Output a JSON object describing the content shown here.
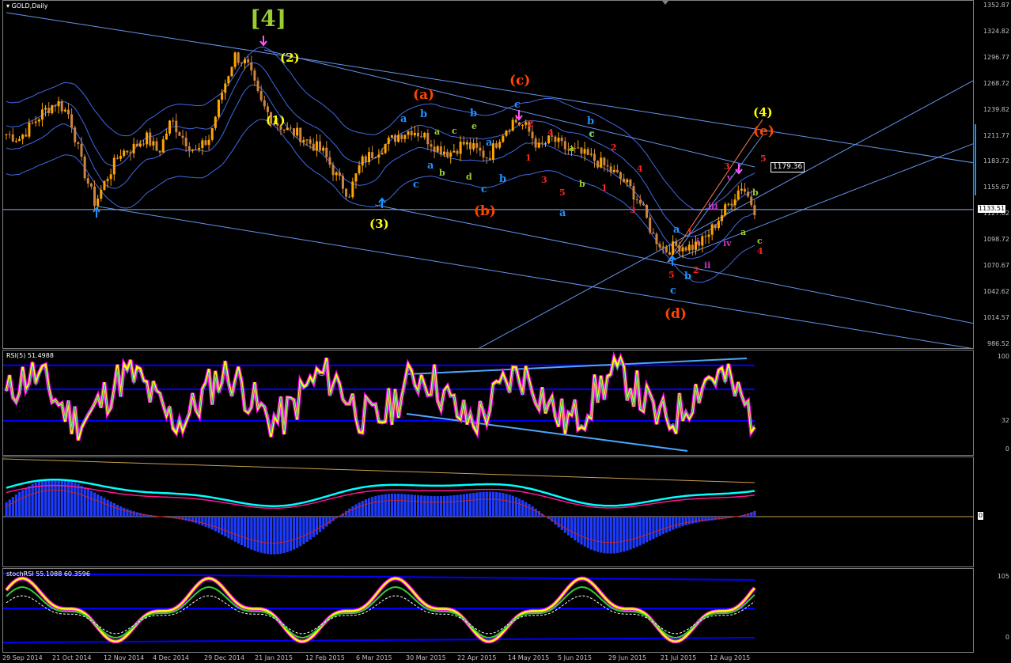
{
  "window": {
    "symbol_title": "GOLD,Daily"
  },
  "panes": {
    "rsi_title": "RSI(5) 51.4988",
    "stoch_title": "stochRSI 55.1088 60.3596"
  },
  "price_axis": [
    "1352.87",
    "1324.82",
    "1296.77",
    "1268.72",
    "1239.82",
    "1211.77",
    "1183.72",
    "1155.67",
    "1127.62",
    "1098.72",
    "1070.67",
    "1042.62",
    "1014.57",
    "986.52"
  ],
  "price_marker": "1179.36",
  "current_price": "1133.51",
  "rsi_axis": [
    "100",
    "32",
    "0"
  ],
  "macd_axis": [
    "0"
  ],
  "stoch_axis": [
    "105",
    "0"
  ],
  "x_axis": [
    "29 Sep 2014",
    "21 Oct 2014",
    "12 Nov 2014",
    "4 Dec 2014",
    "29 Dec 2014",
    "21 Jan 2015",
    "12 Feb 2015",
    "6 Mar 2015",
    "30 Mar 2015",
    "22 Apr 2015",
    "14 May 2015",
    "5 Jun 2015",
    "29 Jun 2015",
    "21 Jul 2015",
    "12 Aug 2015"
  ],
  "wave_labels": [
    {
      "t": "[4]",
      "c": "#9acd32",
      "s": 28
    },
    {
      "t": "(1)",
      "c": "#ffff00",
      "s": 15
    },
    {
      "t": "(2)",
      "c": "#ffff00",
      "s": 15
    },
    {
      "t": "(3)",
      "c": "#ffff00",
      "s": 15
    },
    {
      "t": "(4)",
      "c": "#ffff00",
      "s": 15
    },
    {
      "t": "(a)",
      "c": "#ff4500",
      "s": 17
    },
    {
      "t": "(b)",
      "c": "#ff4500",
      "s": 17
    },
    {
      "t": "(c)",
      "c": "#ff4500",
      "s": 17
    },
    {
      "t": "(d)",
      "c": "#ff4500",
      "s": 17
    },
    {
      "t": "(e)",
      "c": "#ff4500",
      "s": 17
    },
    {
      "t": "a",
      "c": "#1e90ff",
      "s": 13
    },
    {
      "t": "b",
      "c": "#1e90ff",
      "s": 13
    },
    {
      "t": "c",
      "c": "#1e90ff",
      "s": 13
    },
    {
      "t": "a",
      "c": "#1e90ff",
      "s": 13
    },
    {
      "t": "b",
      "c": "#1e90ff",
      "s": 13
    },
    {
      "t": "c",
      "c": "#1e90ff",
      "s": 13
    },
    {
      "t": "a",
      "c": "#1e90ff",
      "s": 13
    },
    {
      "t": "b",
      "c": "#1e90ff",
      "s": 13
    },
    {
      "t": "c",
      "c": "#1e90ff",
      "s": 13
    },
    {
      "t": "a",
      "c": "#1e90ff",
      "s": 13
    },
    {
      "t": "b",
      "c": "#1e90ff",
      "s": 13
    },
    {
      "t": "c",
      "c": "#1e90ff",
      "s": 13
    },
    {
      "t": "a",
      "c": "#1e90ff",
      "s": 13
    },
    {
      "t": "b",
      "c": "#1e90ff",
      "s": 13
    },
    {
      "t": "c",
      "c": "#1e90ff",
      "s": 13
    },
    {
      "t": "a",
      "c": "#9acd32",
      "s": 11
    },
    {
      "t": "b",
      "c": "#9acd32",
      "s": 11
    },
    {
      "t": "c",
      "c": "#9acd32",
      "s": 11
    },
    {
      "t": "d",
      "c": "#9acd32",
      "s": 11
    },
    {
      "t": "e",
      "c": "#9acd32",
      "s": 11
    },
    {
      "t": "a",
      "c": "#9acd32",
      "s": 11
    },
    {
      "t": "b",
      "c": "#9acd32",
      "s": 11
    },
    {
      "t": "c",
      "c": "#9acd32",
      "s": 11
    },
    {
      "t": "a",
      "c": "#9acd32",
      "s": 11
    },
    {
      "t": "b",
      "c": "#9acd32",
      "s": 11
    },
    {
      "t": "c",
      "c": "#9acd32",
      "s": 11
    },
    {
      "t": "1",
      "c": "#ff2020",
      "s": 11
    },
    {
      "t": "2",
      "c": "#ff2020",
      "s": 11
    },
    {
      "t": "3",
      "c": "#ff2020",
      "s": 11
    },
    {
      "t": "4",
      "c": "#ff2020",
      "s": 11
    },
    {
      "t": "5",
      "c": "#ff2020",
      "s": 11
    },
    {
      "t": "1",
      "c": "#ff2020",
      "s": 11
    },
    {
      "t": "2",
      "c": "#ff2020",
      "s": 11
    },
    {
      "t": "3",
      "c": "#ff2020",
      "s": 11
    },
    {
      "t": "4",
      "c": "#ff2020",
      "s": 11
    },
    {
      "t": "5",
      "c": "#ff2020",
      "s": 11
    },
    {
      "t": "1",
      "c": "#ff2020",
      "s": 11
    },
    {
      "t": "2",
      "c": "#ff2020",
      "s": 11
    },
    {
      "t": "3",
      "c": "#ff2020",
      "s": 11
    },
    {
      "t": "4",
      "c": "#ff2020",
      "s": 11
    },
    {
      "t": "5",
      "c": "#ff2020",
      "s": 11
    },
    {
      "t": "i",
      "c": "#cc33cc",
      "s": 11
    },
    {
      "t": "ii",
      "c": "#cc33cc",
      "s": 11
    },
    {
      "t": "iii",
      "c": "#cc33cc",
      "s": 11
    },
    {
      "t": "iv",
      "c": "#cc33cc",
      "s": 11
    },
    {
      "t": "v",
      "c": "#cc33cc",
      "s": 11
    }
  ],
  "colors": {
    "bull": "#ffa500",
    "bear": "#cd853f",
    "band": "#4169e1",
    "trend": "#6495ed",
    "rsi_main": "#ffff00",
    "rsi_shadow": "#ff00ff",
    "macd_hist": "#1e3cff",
    "macd_line": "#00ffff",
    "signal": "#ff1493",
    "orange_line": "#c8a050"
  },
  "chart_data": [
    {
      "type": "candlestick",
      "title": "GOLD,Daily",
      "ylim": [
        986.52,
        1352.87
      ],
      "x_ticks": [
        "29 Sep 2014",
        "21 Oct 2014",
        "12 Nov 2014",
        "4 Dec 2014",
        "29 Dec 2014",
        "21 Jan 2015",
        "12 Feb 2015",
        "6 Mar 2015",
        "30 Mar 2015",
        "22 Apr 2015",
        "14 May 2015",
        "5 Jun 2015",
        "29 Jun 2015",
        "21 Jul 2015",
        "12 Aug 2015"
      ],
      "close_path": [
        1215,
        1210,
        1225,
        1240,
        1250,
        1235,
        1180,
        1140,
        1170,
        1195,
        1200,
        1212,
        1195,
        1230,
        1210,
        1195,
        1210,
        1260,
        1300,
        1290,
        1250,
        1230,
        1220,
        1215,
        1205,
        1195,
        1170,
        1150,
        1185,
        1195,
        1205,
        1215,
        1220,
        1212,
        1200,
        1195,
        1205,
        1198,
        1190,
        1215,
        1230,
        1222,
        1200,
        1210,
        1200,
        1195,
        1190,
        1182,
        1172,
        1160,
        1140,
        1105,
        1090,
        1095,
        1093,
        1100,
        1120,
        1140,
        1160,
        1134
      ],
      "current": 1133.51,
      "marker": 1179.36
    },
    {
      "type": "line",
      "title": "RSI(5) 51.4988",
      "ylim": [
        0,
        100
      ],
      "last": 51.4988
    },
    {
      "type": "area",
      "title": "MACD histogram",
      "ylim": [
        -1,
        1
      ]
    },
    {
      "type": "line",
      "title": "stochRSI 55.1088 60.3596",
      "ylim": [
        0,
        105
      ],
      "series": [
        {
          "last": 55.1088
        },
        {
          "last": 60.3596
        }
      ]
    }
  ]
}
